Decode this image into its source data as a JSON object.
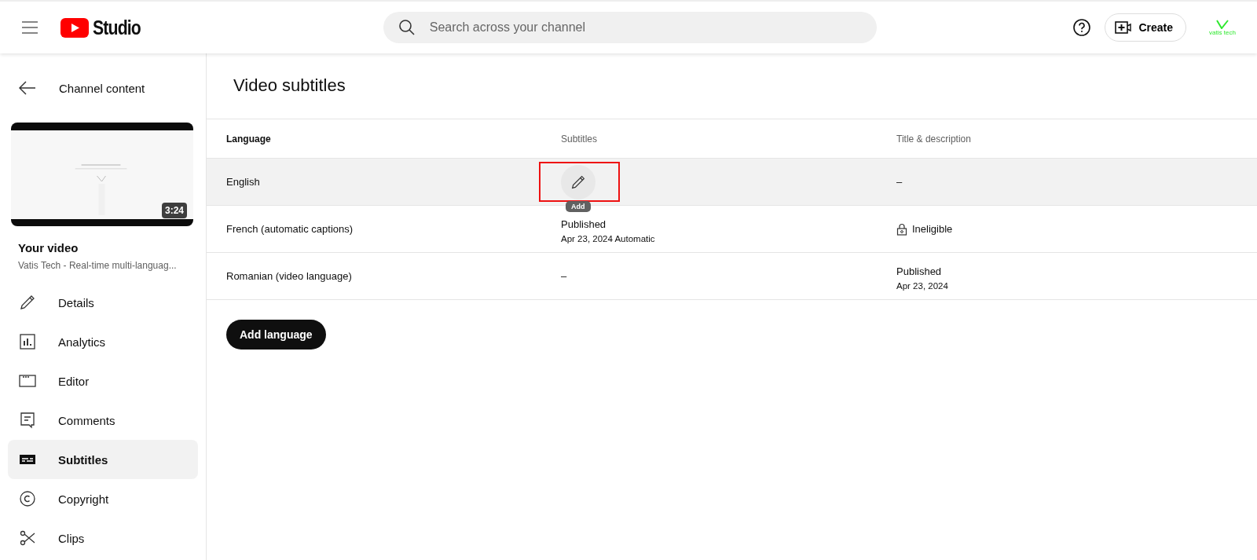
{
  "header": {
    "logo_text": "Studio",
    "search": {
      "placeholder": "Search across your channel"
    },
    "create_button": "Create",
    "avatar_text": "vatis tech"
  },
  "sidebar": {
    "back_label": "Channel content",
    "video": {
      "duration": "3:24",
      "title": "Your video",
      "channel": "Vatis Tech - Real-time multi-languag..."
    },
    "items": [
      {
        "label": "Details",
        "kind": "pencil",
        "selected": false
      },
      {
        "label": "Analytics",
        "kind": "analytics",
        "selected": false
      },
      {
        "label": "Editor",
        "kind": "editor",
        "selected": false
      },
      {
        "label": "Comments",
        "kind": "comments",
        "selected": false
      },
      {
        "label": "Subtitles",
        "kind": "subtitles",
        "selected": true
      },
      {
        "label": "Copyright",
        "kind": "copyright",
        "selected": false
      },
      {
        "label": "Clips",
        "kind": "clips",
        "selected": false
      }
    ]
  },
  "page_title": "Video subtitles",
  "table": {
    "columns": [
      "Language",
      "Subtitles",
      "Title & description"
    ],
    "rows": [
      {
        "language": "English",
        "hovered": true,
        "subtitles": {
          "kind": "edit",
          "highlighted": true,
          "tooltip": "Add"
        },
        "title_description": {
          "kind": "dash",
          "text": "–"
        }
      },
      {
        "language": "French (automatic captions)",
        "hovered": false,
        "subtitles": {
          "kind": "status",
          "status": "Published",
          "date": "Apr 23, 2024 Automatic"
        },
        "title_description": {
          "kind": "ineligible",
          "text": "Ineligible"
        }
      },
      {
        "language": "Romanian (video language)",
        "hovered": false,
        "subtitles": {
          "kind": "dash",
          "text": "–"
        },
        "title_description": {
          "kind": "status",
          "status": "Published",
          "date": "Apr 23, 2024"
        }
      }
    ]
  },
  "add_language_button": "Add language"
}
